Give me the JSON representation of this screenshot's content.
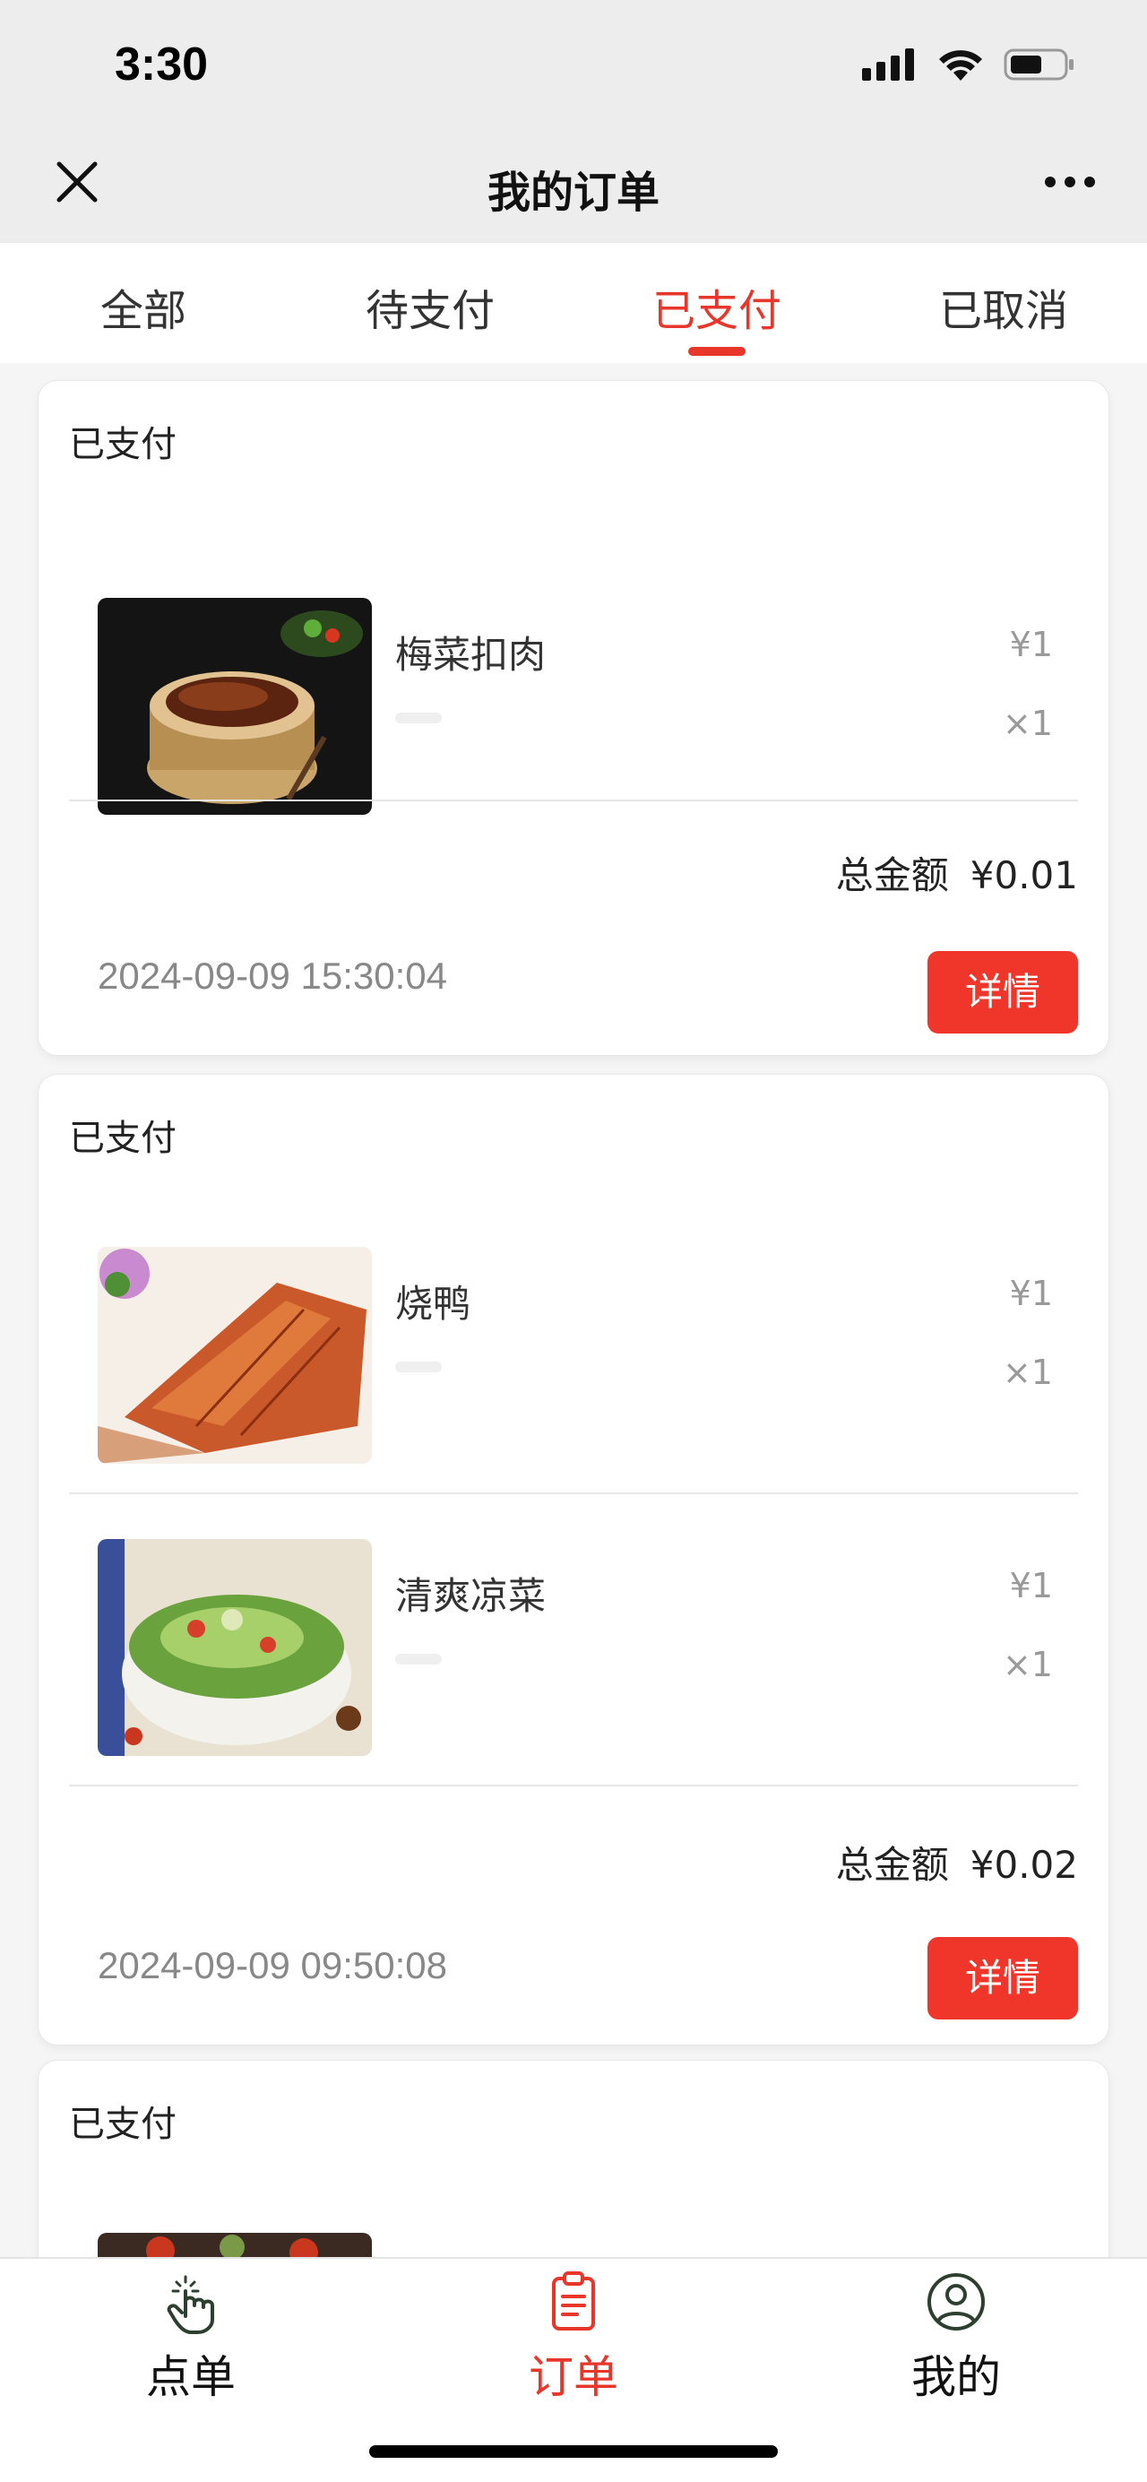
{
  "status_bar": {
    "time": "3:30"
  },
  "nav": {
    "title": "我的订单",
    "close_icon": "close-icon",
    "more_icon": "more-icon"
  },
  "tabs": [
    {
      "label": "全部",
      "active": false
    },
    {
      "label": "待支付",
      "active": false
    },
    {
      "label": "已支付",
      "active": true
    },
    {
      "label": "已取消",
      "active": false
    }
  ],
  "orders": [
    {
      "status": "已支付",
      "items": [
        {
          "name": "梅菜扣肉",
          "price": "¥1",
          "qty": "×1",
          "image": "pork-dish"
        }
      ],
      "total_label": "总金额",
      "total_value": "¥0.01",
      "time": "2024-09-09 15:30:04",
      "detail_label": "详情"
    },
    {
      "status": "已支付",
      "items": [
        {
          "name": "烧鸭",
          "price": "¥1",
          "qty": "×1",
          "image": "roast-duck"
        },
        {
          "name": "清爽凉菜",
          "price": "¥1",
          "qty": "×1",
          "image": "cold-dish"
        }
      ],
      "total_label": "总金额",
      "total_value": "¥0.02",
      "time": "2024-09-09 09:50:08",
      "detail_label": "详情"
    },
    {
      "status": "已支付",
      "items": [
        {
          "image": "dish"
        }
      ]
    }
  ],
  "bottom_tabs": [
    {
      "label": "点单",
      "icon": "tap-hand-icon",
      "active": false
    },
    {
      "label": "订单",
      "icon": "clipboard-icon",
      "active": true
    },
    {
      "label": "我的",
      "icon": "user-icon",
      "active": false
    }
  ],
  "colors": {
    "accent": "#e8362b",
    "button": "#f0362a",
    "background": "#f5f5f5"
  }
}
